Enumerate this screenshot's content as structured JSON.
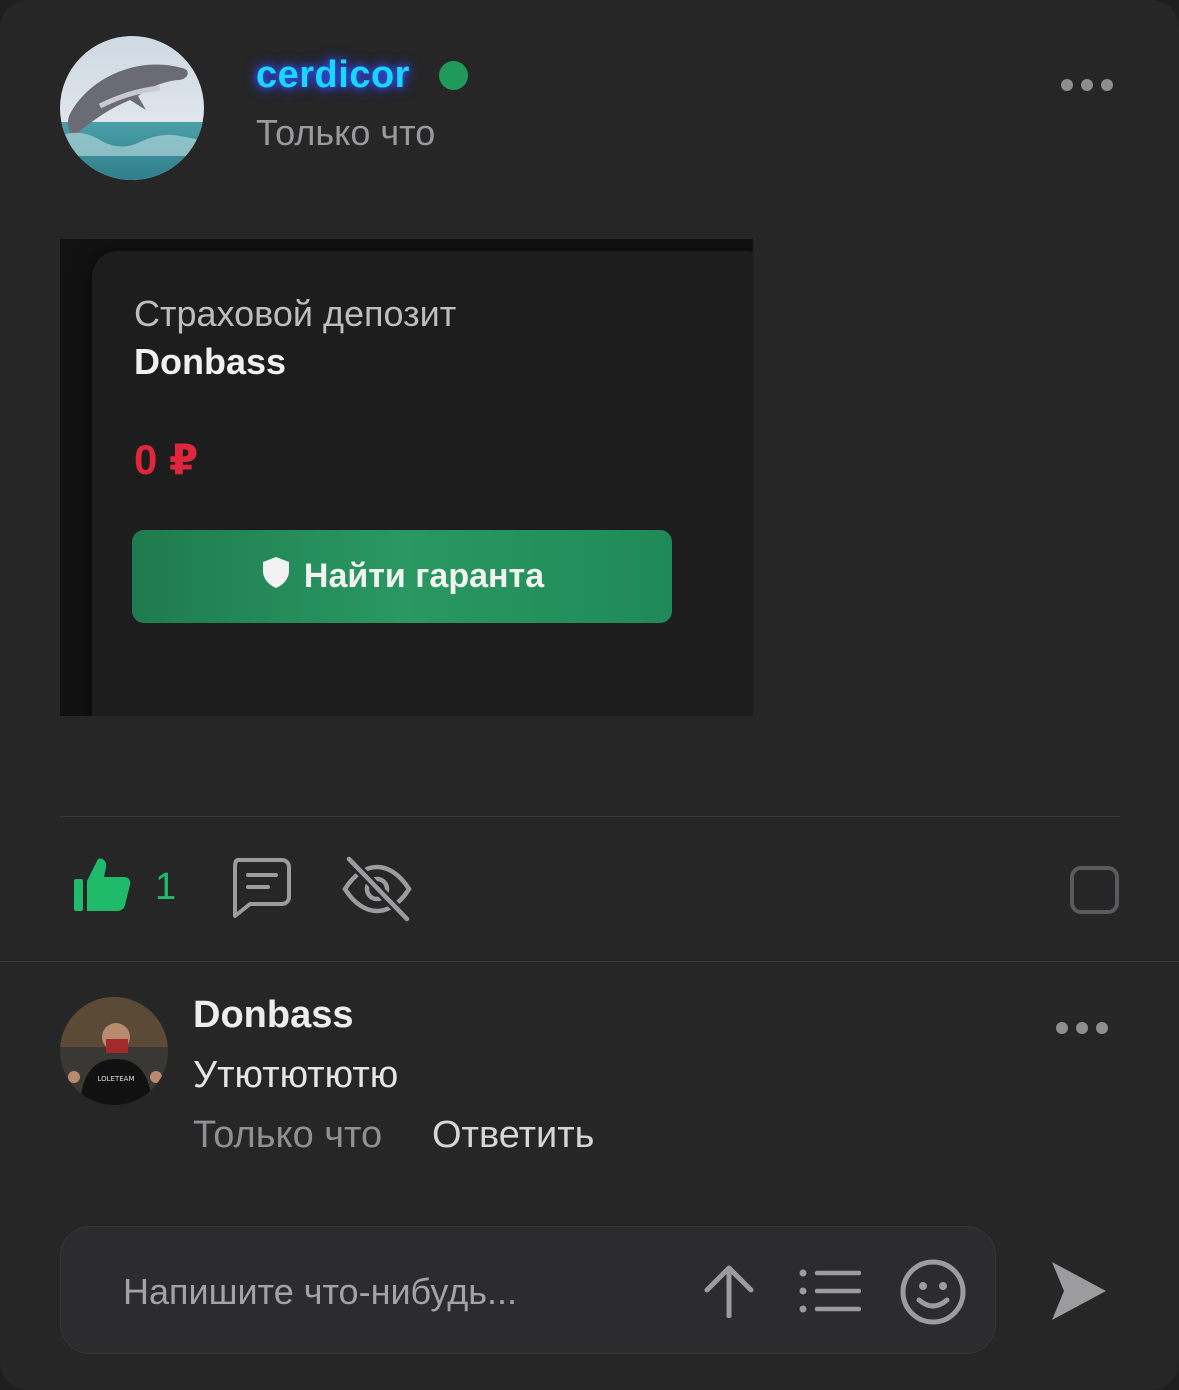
{
  "post": {
    "author": "cerdicor",
    "online": true,
    "time": "Только что",
    "more_icon": "more-horizontal-icon"
  },
  "attachment": {
    "title": "Страховой депозит",
    "name": "Donbass",
    "amount": "0 ₽",
    "button_label": "Найти гаранта",
    "button_icon": "shield-icon"
  },
  "actions": {
    "like_count": "1",
    "like_icon": "thumbs-up-icon",
    "comment_icon": "comment-icon",
    "hide_icon": "eye-off-icon",
    "select_icon": "checkbox-icon"
  },
  "comment": {
    "author": "Donbass",
    "text": "Утютютютю",
    "time": "Только что",
    "reply_label": "Ответить"
  },
  "composer": {
    "placeholder": "Напишите что-нибудь...",
    "icons": [
      "upload-arrow-icon",
      "list-icon",
      "emoji-icon",
      "send-icon"
    ]
  },
  "colors": {
    "background": "#262627",
    "accent_green": "#1fbb6a",
    "username": "#19d8ff",
    "amount_red": "#e0263c"
  }
}
